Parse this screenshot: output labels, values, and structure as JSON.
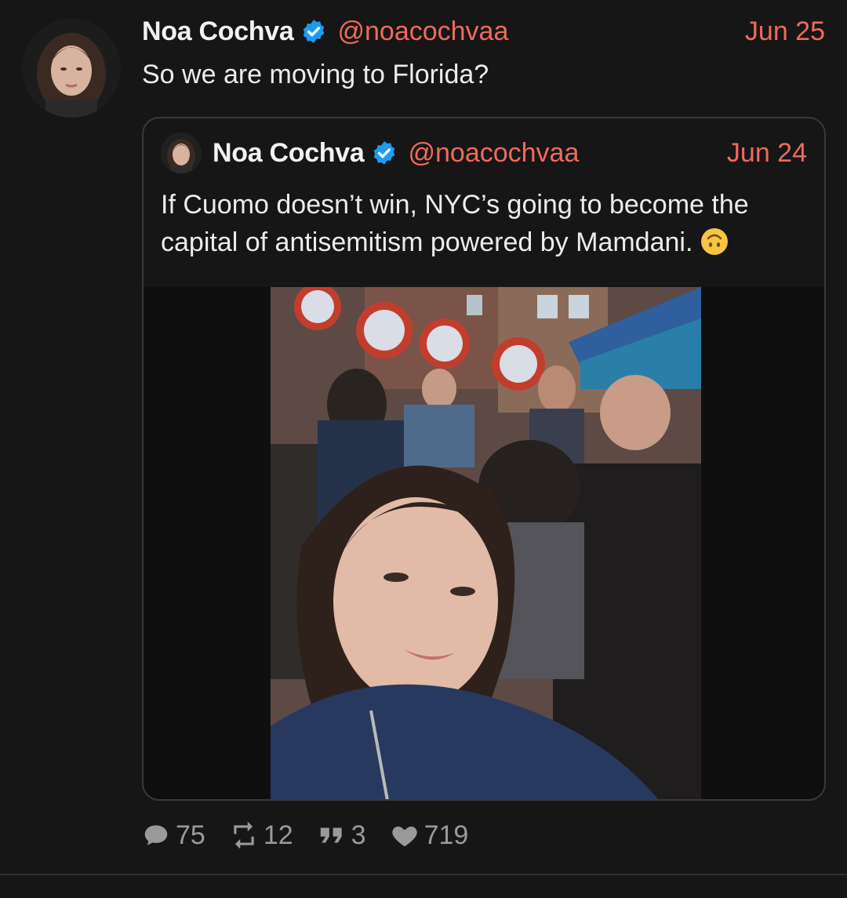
{
  "tweet": {
    "author_name": "Noa Cochva",
    "handle": "@noacochvaa",
    "date": "Jun 25",
    "text": "So we are moving to Florida?",
    "verified_icon": "verified-badge-icon"
  },
  "quoted_tweet": {
    "author_name": "Noa Cochva",
    "handle": "@noacochvaa",
    "date": "Jun 24",
    "text": "If Cuomo doesn’t win, NYC’s going to become the capital of antisemitism powered by Mamdani.",
    "emoji": "upside-down-face-emoji",
    "media": "selfie-photo-at-rally"
  },
  "actions": {
    "replies": "75",
    "retweets": "12",
    "quotes": "3",
    "likes": "719"
  },
  "colors": {
    "background": "#161616",
    "accent": "#f06a5b",
    "verified": "#1d9bf0",
    "muted": "#9a9a9a"
  }
}
